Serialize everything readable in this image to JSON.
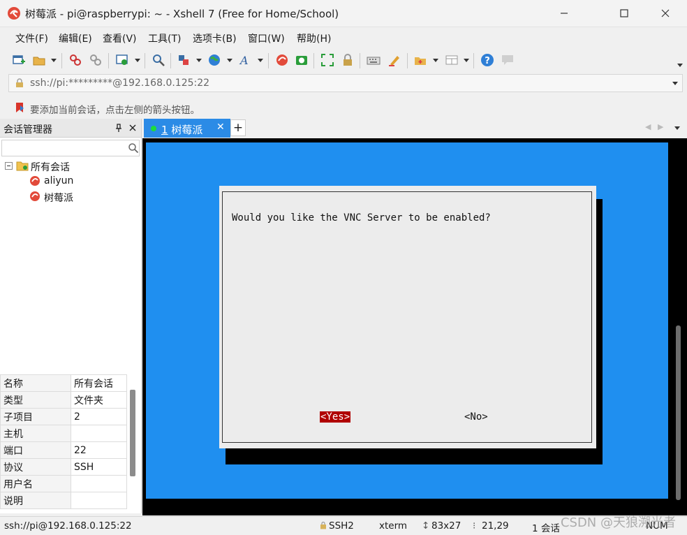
{
  "window": {
    "title": "树莓派 - pi@raspberrypi: ~ - Xshell 7 (Free for Home/School)",
    "minimize_icon": "minimize-icon",
    "maximize_icon": "maximize-icon",
    "close_icon": "close-icon"
  },
  "menu": [
    "文件(F)",
    "编辑(E)",
    "查看(V)",
    "工具(T)",
    "选项卡(B)",
    "窗口(W)",
    "帮助(H)"
  ],
  "address": {
    "text": "ssh://pi:*********@192.168.0.125:22"
  },
  "hint": {
    "text": "要添加当前会话，点击左侧的箭头按钮。"
  },
  "session_manager": {
    "title": "会话管理器",
    "pin_icon": "pin-icon",
    "tree": {
      "root": "所有会话",
      "children": [
        "aliyun",
        "树莓派"
      ]
    },
    "properties": [
      {
        "key": "名称",
        "value": "所有会话"
      },
      {
        "key": "类型",
        "value": "文件夹"
      },
      {
        "key": "子项目",
        "value": "2"
      },
      {
        "key": "主机",
        "value": ""
      },
      {
        "key": "端口",
        "value": "22"
      },
      {
        "key": "协议",
        "value": "SSH"
      },
      {
        "key": "用户名",
        "value": ""
      },
      {
        "key": "说明",
        "value": ""
      }
    ]
  },
  "tabs": {
    "active": {
      "number": "1",
      "label": "树莓派"
    },
    "add_label": "+"
  },
  "terminal": {
    "dialog_message": "Would you like the VNC Server to be enabled?",
    "yes_label": "<Yes>",
    "no_label": "<No>"
  },
  "status": {
    "connection": "ssh://pi@192.168.0.125:22",
    "protocol": "SSH2",
    "terminal_type": "xterm",
    "size": "83x27",
    "cursor": "21,29",
    "sessions": "1 会话",
    "num": "NUM"
  },
  "watermark": "CSDN @天狼溯光者",
  "colors": {
    "terminal_bg": "#1f8ff0",
    "tab_active": "#2b8be6",
    "yes_highlight": "#b00000"
  }
}
